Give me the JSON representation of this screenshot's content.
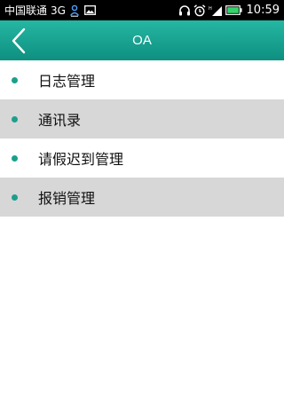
{
  "status_bar": {
    "carrier": "中国联通",
    "network": "3G",
    "time": "10:59",
    "icons": [
      "user-sync-icon",
      "image-icon",
      "headset-icon",
      "alarm-icon",
      "signal-icon",
      "battery-icon"
    ]
  },
  "header": {
    "title": "OA",
    "back_icon": "back-chevron-icon"
  },
  "menu": {
    "items": [
      {
        "label": "日志管理"
      },
      {
        "label": "通讯录"
      },
      {
        "label": "请假迟到管理"
      },
      {
        "label": "报销管理"
      }
    ]
  },
  "colors": {
    "accent": "#1aa08c",
    "header_top": "#25b7a3",
    "header_bottom": "#0e8f80",
    "row_shade": "#d7d7d7"
  }
}
